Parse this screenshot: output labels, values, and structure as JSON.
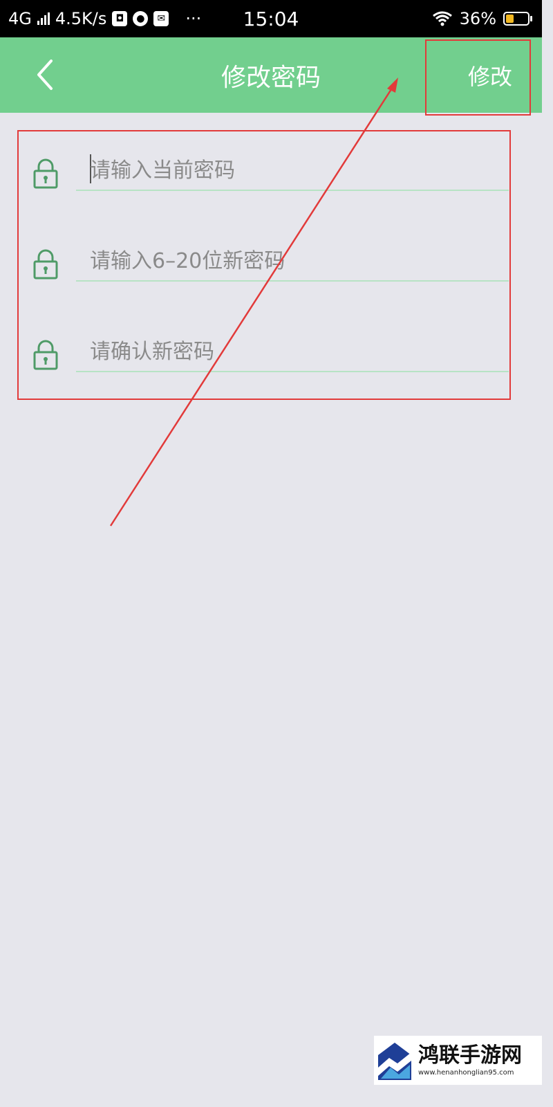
{
  "status_bar": {
    "network": "4G",
    "speed": "4.5K/s",
    "time": "15:04",
    "more": "···",
    "battery_percent": "36%",
    "battery_level": 0.36,
    "battery_color": "#f2b821"
  },
  "header": {
    "title": "修改密码",
    "submit_label": "修改",
    "back_icon": "chevron-left-icon",
    "background": "#72cf8e"
  },
  "fields": [
    {
      "placeholder": "请输入当前密码",
      "icon": "lock-icon"
    },
    {
      "placeholder": "请输入6–20位新密码",
      "icon": "lock-icon"
    },
    {
      "placeholder": "请确认新密码",
      "icon": "lock-icon"
    }
  ],
  "annotation": {
    "color": "#e23a3a"
  },
  "watermark": {
    "name": "鸿联手游网",
    "url": "www.henanhonglian95.com"
  }
}
